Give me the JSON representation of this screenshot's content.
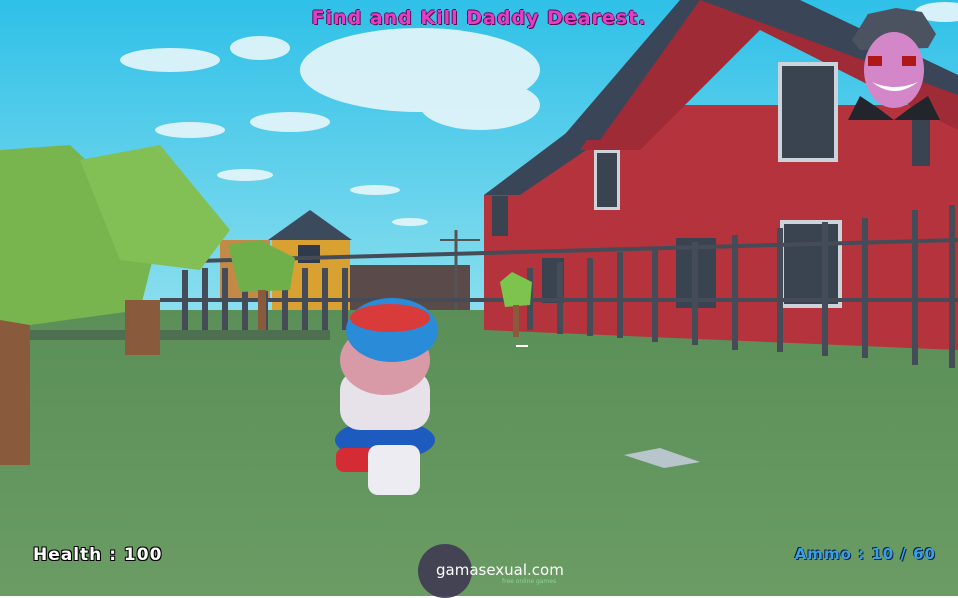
{
  "objective": "Find and Kill Daddy Dearest.",
  "hud": {
    "health_label": "Health : 100",
    "health_value": 100,
    "ammo_label": "Ammo : 10 / 60",
    "ammo_current": 10,
    "ammo_max": 60
  },
  "watermark": {
    "site": "gamasexual.com",
    "tagline": "free online games"
  },
  "colors": {
    "objective_text": "#e43ec8",
    "ammo_text": "#3aa0e6",
    "health_text": "#ffffff",
    "sky": "#39c6e6",
    "grass": "#63915f",
    "barn": "#b5333d"
  },
  "scene": {
    "character": "player boy in blue cap",
    "enemy_portrait": "daddy-dearest-portrait"
  }
}
